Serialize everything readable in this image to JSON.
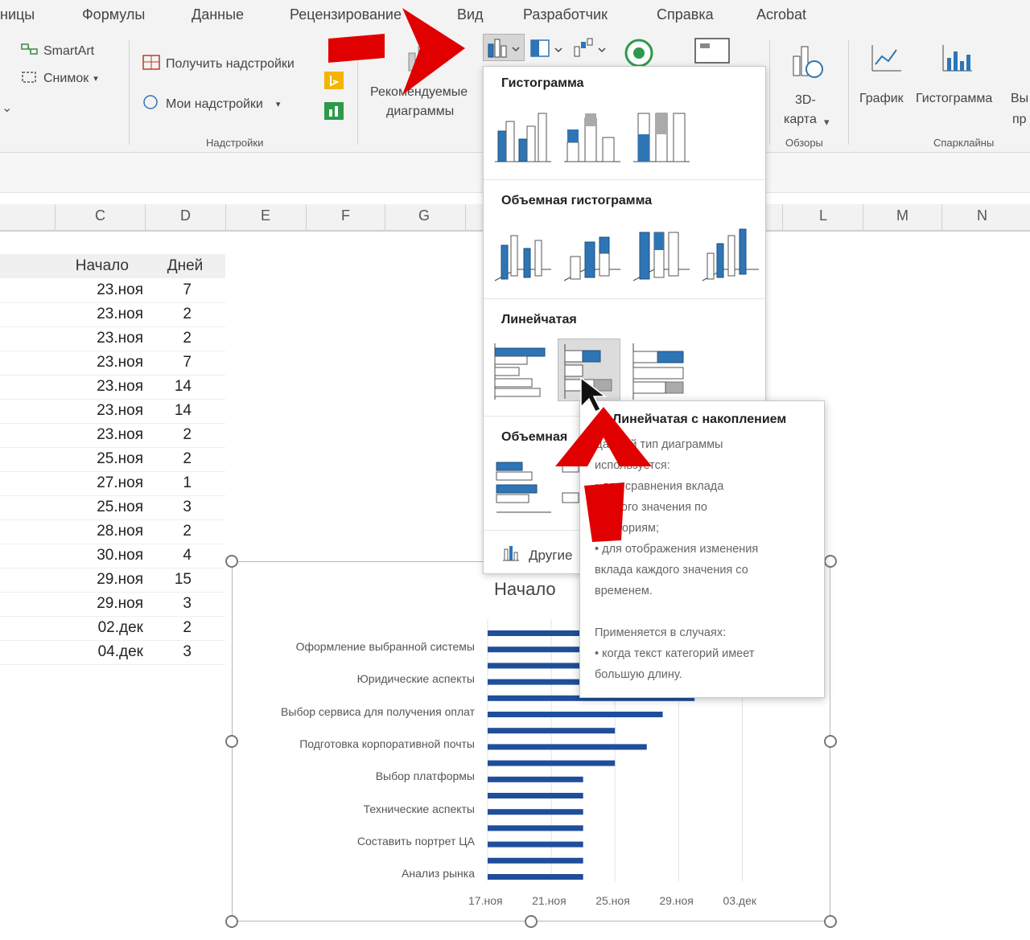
{
  "menu": {
    "tabs": [
      "ницы",
      "Формулы",
      "Данные",
      "Рецензирование",
      "Вид",
      "Разработчик",
      "Справка",
      "Acrobat"
    ]
  },
  "ribbon": {
    "smartart": "SmartArt",
    "snapshot": "Снимок",
    "get_addins": "Получить надстройки",
    "my_addins": "Мои надстройки",
    "addins_group": "Надстройки",
    "recommended_1": "Рекомендуемые",
    "recommended_2": "диаграммы",
    "map3d_1": "3D-",
    "map3d_2": "карта",
    "tours_group": "Обзоры",
    "spark_line": "График",
    "spark_column": "Гистограмма",
    "spark_winloss": "Вы",
    "spark_winloss_2": "пр",
    "sparklines_group": "Спарклайны"
  },
  "columns": [
    "C",
    "D",
    "E",
    "F",
    "G",
    "L",
    "M",
    "N"
  ],
  "table": {
    "headers": [
      "Начало",
      "Дней"
    ],
    "rows": [
      [
        "23.ноя",
        "7"
      ],
      [
        "23.ноя",
        "2"
      ],
      [
        "23.ноя",
        "2"
      ],
      [
        "23.ноя",
        "7"
      ],
      [
        "23.ноя",
        "14"
      ],
      [
        "23.ноя",
        "14"
      ],
      [
        "23.ноя",
        "2"
      ],
      [
        "25.ноя",
        "2"
      ],
      [
        "27.ноя",
        "1"
      ],
      [
        "25.ноя",
        "3"
      ],
      [
        "28.ноя",
        "2"
      ],
      [
        "30.ноя",
        "4"
      ],
      [
        "29.ноя",
        "15"
      ],
      [
        "29.ноя",
        "3"
      ],
      [
        "02.дек",
        "2"
      ],
      [
        "04.дек",
        "3"
      ]
    ]
  },
  "dropdown": {
    "section_column": "Гистограмма",
    "section_3d_column": "Объемная гистограмма",
    "section_bar": "Линейчатая",
    "section_3d_bar": "Объемная",
    "more_charts": "Другие"
  },
  "tooltip": {
    "title": "Линейчатая с накоплением",
    "lines": [
      "Данный тип диаграммы",
      "используется:",
      "• для сравнения вклада",
      "каждого значения по",
      "категориям;",
      "• для отображения изменения",
      "вклада каждого значения со",
      "временем.",
      "",
      "Применяется в случаях:",
      "• когда текст категорий имеет",
      "большую длину."
    ]
  },
  "chart_data": {
    "type": "bar",
    "title": "Начало",
    "x_axis_type": "date",
    "x_ticks": [
      "17.ноя",
      "21.ноя",
      "25.ноя",
      "29.ноя",
      "03.дек"
    ],
    "category_labels": [
      "Оформление выбранной системы",
      "Юридические аспекты",
      "Выбор сервиса для получения оплат",
      "Подготовка корпоративной почты",
      "Выбор платформы",
      "Технические аспекты",
      "Составить портрет ЦА",
      "Анализ рынка"
    ],
    "bar_values": [
      "04.дек",
      "02.дек",
      "29.ноя",
      "29.ноя",
      "30.ноя",
      "28.ноя",
      "25.ноя",
      "27.ноя",
      "25.ноя",
      "23.ноя",
      "23.ноя",
      "23.ноя",
      "23.ноя",
      "23.ноя",
      "23.ноя",
      "23.ноя"
    ],
    "bar_color": "#1f4e9b",
    "xlim": [
      "17.ноя",
      "05.дек"
    ]
  },
  "colors": {
    "accent_blue": "#2e75b6",
    "arrow_red": "#e00000",
    "bar_blue": "#1f4e9b"
  }
}
